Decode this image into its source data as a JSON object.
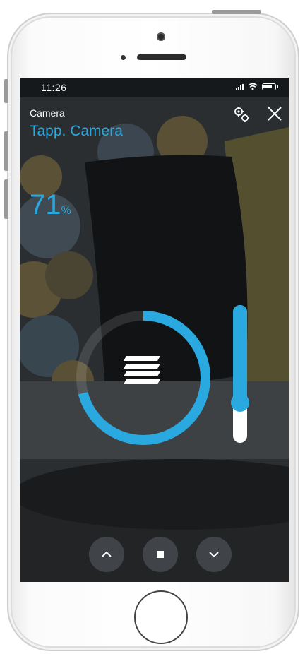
{
  "status_bar": {
    "time": "11:26"
  },
  "header": {
    "subtitle": "Camera",
    "title": "Tapp. Camera"
  },
  "position": {
    "value": "71",
    "unit": "%"
  },
  "slider": {
    "level": 0.71
  },
  "colors": {
    "accent": "#29a9e0"
  },
  "icons": {
    "settings": "settings-gears-icon",
    "close": "close-icon",
    "blinds": "blinds-icon",
    "up": "chevron-up-icon",
    "stop": "stop-icon",
    "down": "chevron-down-icon"
  }
}
